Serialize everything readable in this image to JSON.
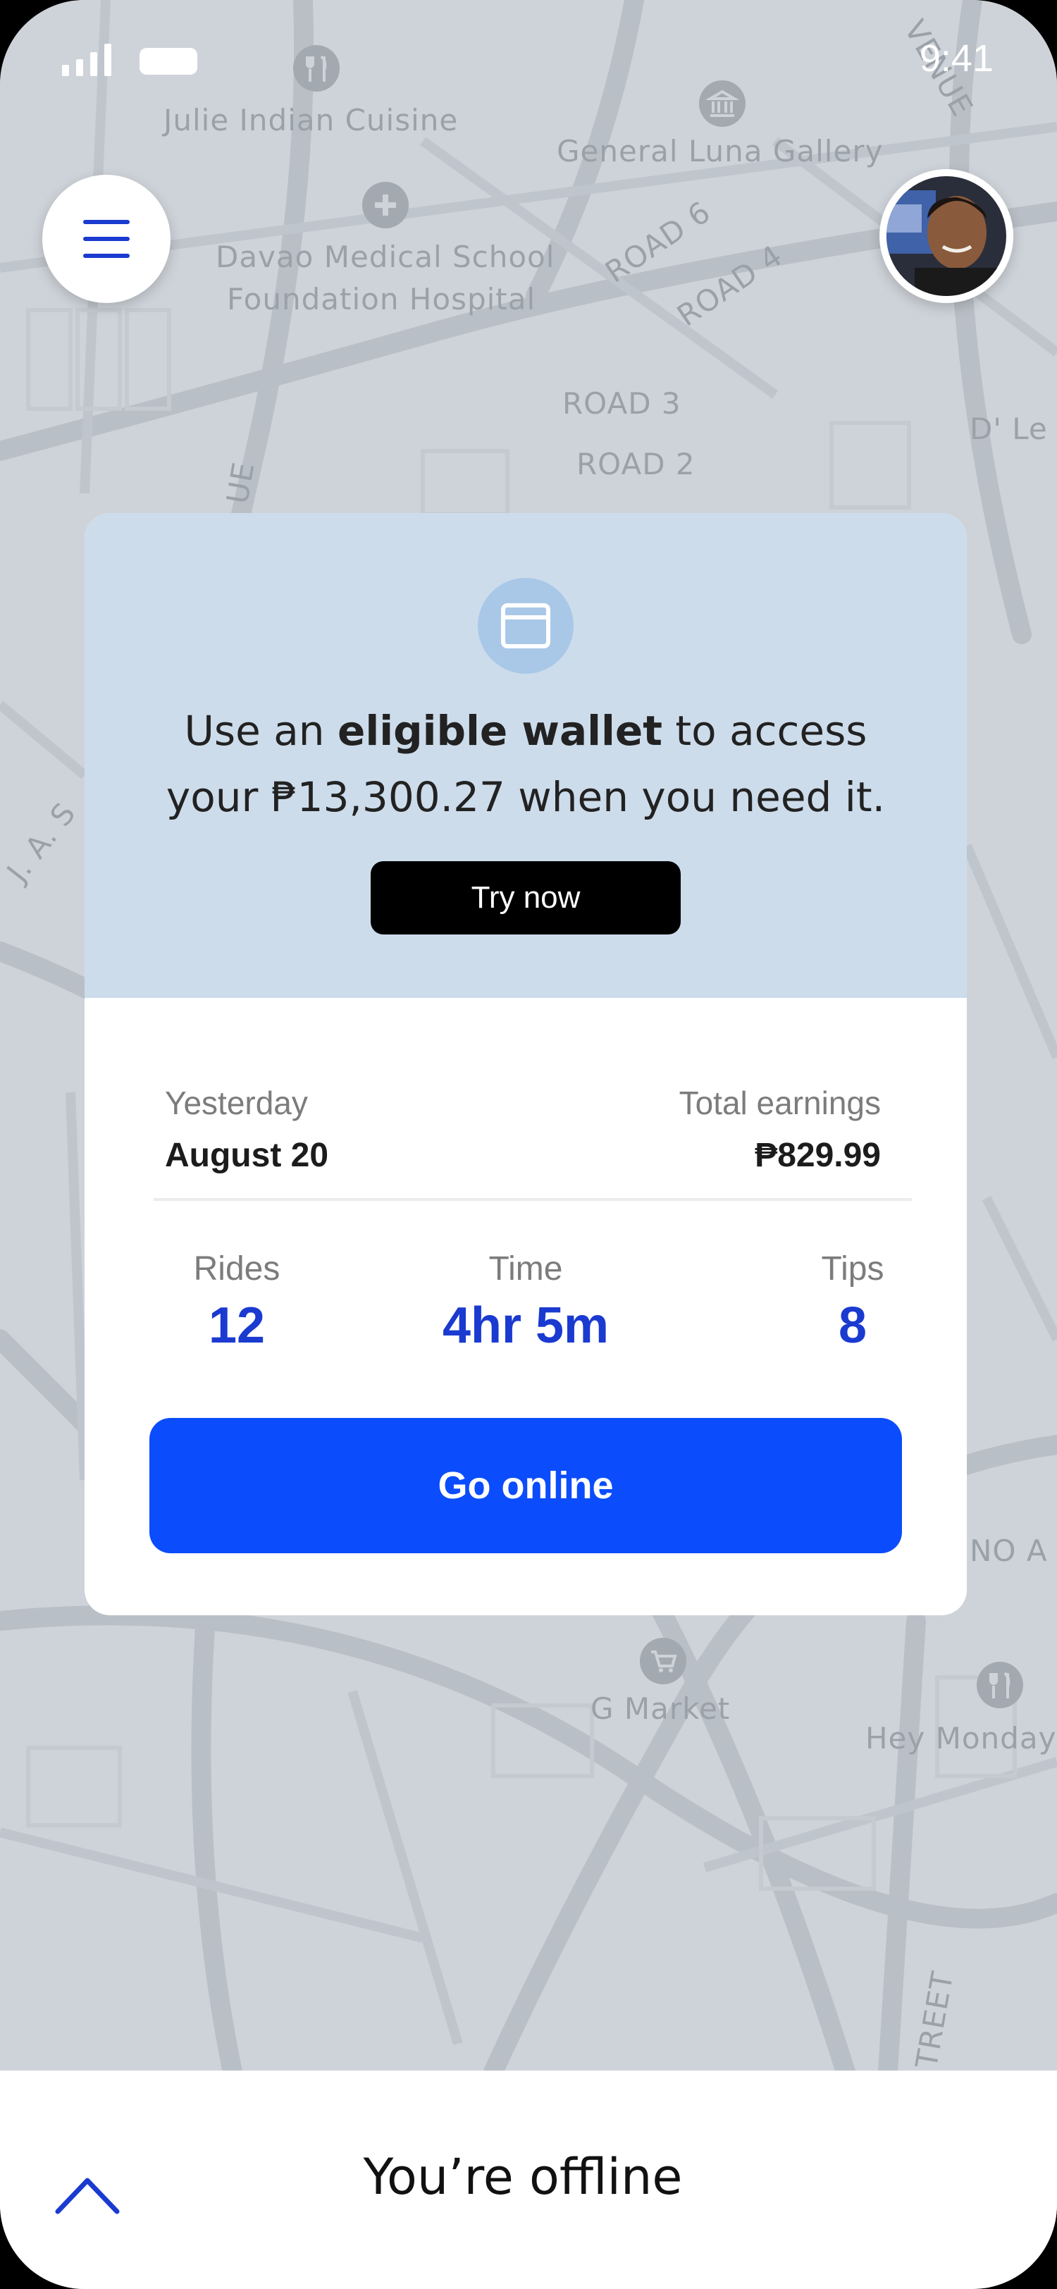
{
  "status_bar": {
    "time": "9:41"
  },
  "map": {
    "labels": [
      "Julie Indian Cuisine",
      "General Luna Gallery",
      "Davao Medical School",
      "Foundation Hospital",
      "ROAD 6",
      "ROAD 4",
      "ROAD 3",
      "ROAD 2",
      "D' Le",
      "J. A. S",
      "G Market",
      "Hey Monday",
      "NO A",
      "TREET",
      "VENUE",
      "UE"
    ]
  },
  "promo": {
    "text_prefix": "Use an ",
    "text_bold": "eligible wallet",
    "text_mid": " to access",
    "text_line2_prefix": "your ",
    "amount": "₱13,300.27",
    "text_suffix": " when you need it.",
    "button_label": "Try now",
    "icon": "wallet-icon"
  },
  "earnings": {
    "period_label": "Yesterday",
    "date": "August 20",
    "total_label": "Total earnings",
    "total_value": "₱829.99"
  },
  "stats": {
    "rides_label": "Rides",
    "rides_value": "12",
    "time_label": "Time",
    "time_value": "4hr 5m",
    "tips_label": "Tips",
    "tips_value": "8"
  },
  "actions": {
    "go_online_label": "Go online"
  },
  "bottom_sheet": {
    "status_text": "You’re offline"
  },
  "colors": {
    "accent": "#0b4cfc",
    "stat_blue": "#1a3ad0",
    "promo_bg": "#cddceb"
  }
}
